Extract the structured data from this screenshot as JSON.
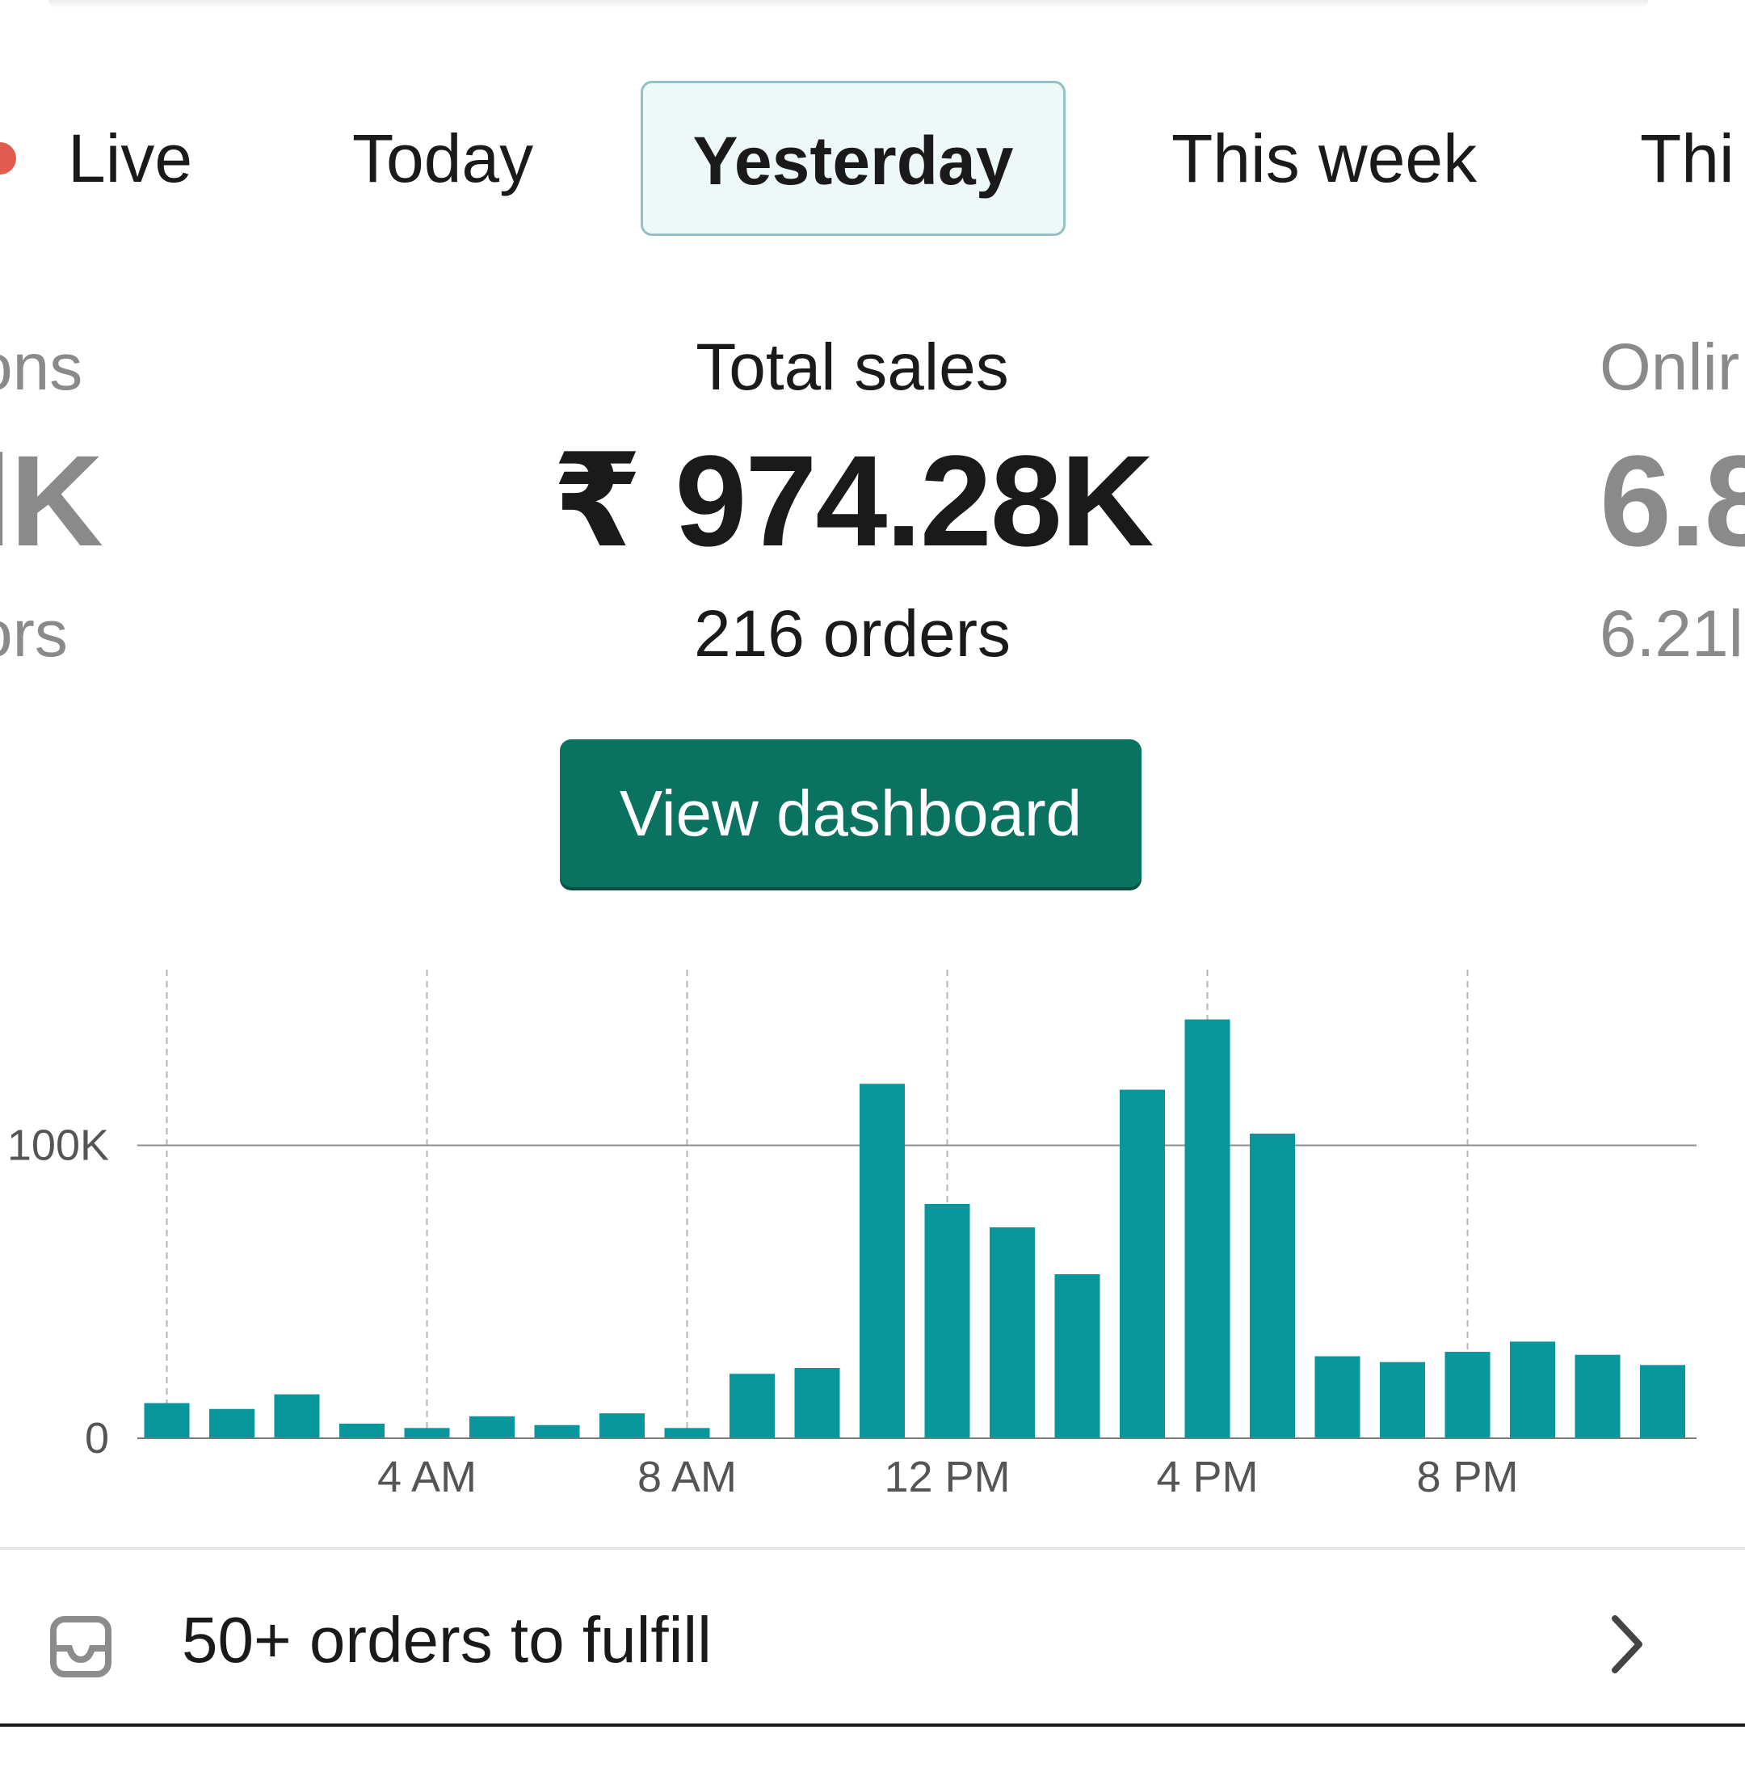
{
  "tabs": [
    {
      "label": "Live"
    },
    {
      "label": "Today"
    },
    {
      "label": "Yesterday"
    },
    {
      "label": "This week"
    },
    {
      "label": "Thi"
    }
  ],
  "selected_tab": "Yesterday",
  "metrics": {
    "left": {
      "label": "ons",
      "value": "lK",
      "sub": "ors"
    },
    "center": {
      "label": "Total sales",
      "value": "₹ 974.28K",
      "sub": "216 orders"
    },
    "right": {
      "label": "Onlir",
      "value": "6.8",
      "sub": "6.21l"
    }
  },
  "view_dashboard_label": "View dashboard",
  "fulfill": {
    "label": "50+ orders to fulfill",
    "icon": "inbox-icon",
    "chevron": "chevron-right-icon"
  },
  "colors": {
    "accent": "#0a735f",
    "bar": "#07969b",
    "live_dot": "#e15b4e"
  },
  "chart_data": {
    "type": "bar",
    "x": [
      0,
      1,
      2,
      3,
      4,
      5,
      6,
      7,
      8,
      9,
      10,
      11,
      12,
      13,
      14,
      15,
      16,
      17,
      18,
      19,
      20,
      21,
      22,
      23
    ],
    "values": [
      12000,
      10000,
      15000,
      5000,
      3500,
      7500,
      4500,
      8500,
      3500,
      22000,
      24000,
      121000,
      80000,
      72000,
      56000,
      119000,
      143000,
      104000,
      28000,
      26000,
      29500,
      33000,
      28500,
      25000
    ],
    "ylim": [
      0,
      160000
    ],
    "yticks": [
      {
        "value": 0,
        "label": "0"
      },
      {
        "value": 100000,
        "label": "100K"
      }
    ],
    "xticks": [
      {
        "value": 4,
        "label": "4 AM"
      },
      {
        "value": 8,
        "label": "8 AM"
      },
      {
        "value": 12,
        "label": "12 PM"
      },
      {
        "value": 16,
        "label": "4 PM"
      },
      {
        "value": 20,
        "label": "8 PM"
      }
    ],
    "grid": true
  }
}
